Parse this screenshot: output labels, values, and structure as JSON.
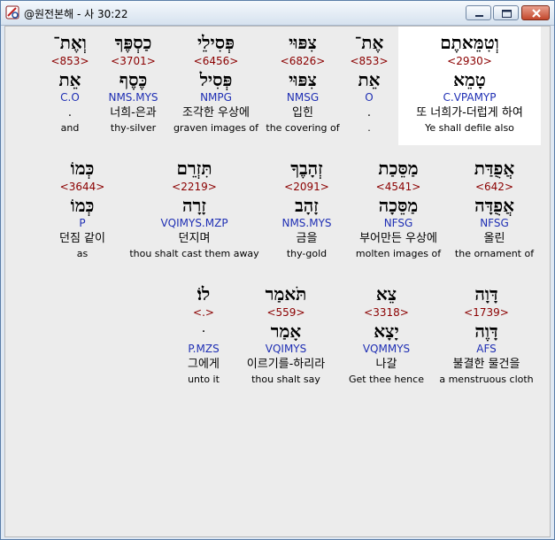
{
  "window": {
    "title": "@원전본해 - 사 30:22"
  },
  "rows": [
    [
      {
        "heb": "וְטִמֵּאתֶם",
        "strong": "<2930>",
        "lemma": "טָמֵא",
        "parse": "C.VPAMYP",
        "kor": "또 너희가-더럽게 하여",
        "eng": "Ye shall defile also",
        "selected": true
      },
      {
        "heb": "אֶת־",
        "strong": "<853>",
        "lemma": "אֵת",
        "parse": "O",
        "kor": ".",
        "eng": "."
      },
      {
        "heb": "צִפּוּי",
        "strong": "<6826>",
        "lemma": "צִפּוּי",
        "parse": "NMSG",
        "kor": "입힌",
        "eng": "the covering of"
      },
      {
        "heb": "פְּסִילֵי",
        "strong": "<6456>",
        "lemma": "פְּסִיל",
        "parse": "NMPG",
        "kor": "조각한 우상에",
        "eng": "graven images of"
      },
      {
        "heb": "כַסְפֶּךָ",
        "strong": "<3701>",
        "lemma": "כֶּסֶף",
        "parse": "NMS.MYS",
        "kor": "너희-은과",
        "eng": "thy-silver"
      },
      {
        "heb": "וְאֶת־",
        "strong": "<853>",
        "lemma": "אֵת",
        "parse": "C.O",
        "kor": ".",
        "eng": "and"
      }
    ],
    [
      {
        "heb": "אֲפֻדַּת",
        "strong": "<642>",
        "lemma": "אֲפֻדָּה",
        "parse": "NFSG",
        "kor": "올린",
        "eng": "the ornament of"
      },
      {
        "heb": "מַסֵּכַת",
        "strong": "<4541>",
        "lemma": "מַסֵּכָה",
        "parse": "NFSG",
        "kor": "부어만든 우상에",
        "eng": "molten images of"
      },
      {
        "heb": "זְהָבֶךָ",
        "strong": "<2091>",
        "lemma": "זָהָב",
        "parse": "NMS.MYS",
        "kor": "금을",
        "eng": "thy-gold"
      },
      {
        "heb": "תִּזְרֵם",
        "strong": "<2219>",
        "lemma": "זָרָה",
        "parse": "VQIMYS.MZP",
        "kor": "던지며",
        "eng": "thou shalt cast them away"
      },
      {
        "heb": "כְּמוֹ",
        "strong": "<3644>",
        "lemma": "כְּמוֹ",
        "parse": "P",
        "kor": "던짐 같이",
        "eng": "as"
      }
    ],
    [
      {
        "heb": "דָּוָה",
        "strong": "<1739>",
        "lemma": "דָּוֶה",
        "parse": "AFS",
        "kor": "불결한 물건을",
        "eng": "a menstruous cloth"
      },
      {
        "heb": "צֵא",
        "strong": "<3318>",
        "lemma": "יָצָא",
        "parse": "VQMMYS",
        "kor": "나갈",
        "eng": "Get thee hence"
      },
      {
        "heb": "תֹּאמַר",
        "strong": "<559>",
        "lemma": "אָמַר",
        "parse": "VQIMYS",
        "kor": "이르기를-하리라",
        "eng": "thou shalt say"
      },
      {
        "heb": "לוֹ׃",
        "strong": "<.>",
        "lemma": "ּ",
        "parse": "P.MZS",
        "kor": "그에게",
        "eng": "unto it"
      }
    ]
  ]
}
